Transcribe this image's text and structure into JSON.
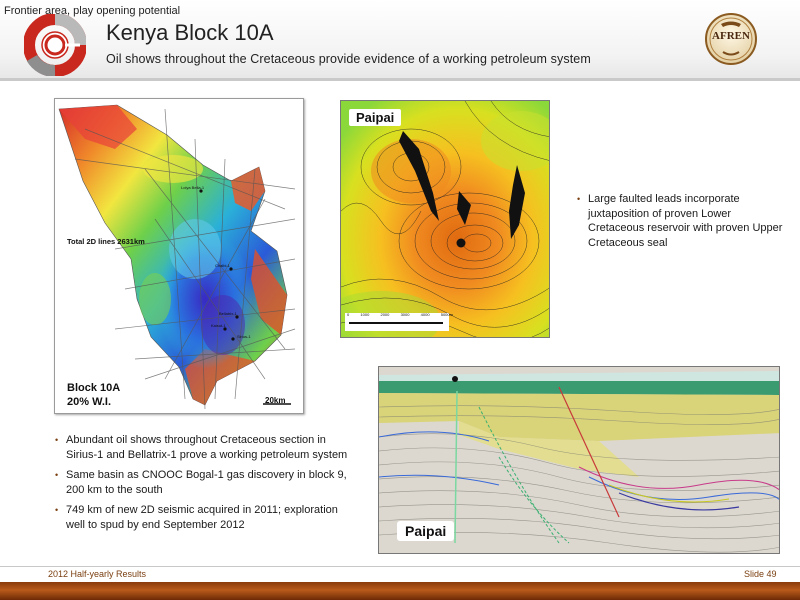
{
  "header": {
    "tagline": "Frontier area, play opening potential",
    "title": "Kenya Block 10A",
    "subtitle": "Oil shows throughout the Cretaceous provide evidence of a working petroleum system",
    "brand": "AFREN"
  },
  "basin_map": {
    "lines_label": "Total 2D lines 2631km",
    "block_label": "Block 10A",
    "interest_label": "20% W.I.",
    "scale_label": "20km",
    "wells": [
      "Loiya Bella-1",
      "Chalbi-1",
      "Bellatrix-1",
      "Kaisut-1",
      "Sirius-1"
    ]
  },
  "contour_map": {
    "label": "Paipai",
    "scale_ticks": [
      "0",
      "1000",
      "2000",
      "3000",
      "4000",
      "5000m"
    ]
  },
  "seismic_section": {
    "label": "Paipai"
  },
  "right_bullets": [
    "Large faulted leads incorporate juxtaposition of proven Lower Cretaceous reservoir with proven Upper Cretaceous seal"
  ],
  "left_bullets": [
    "Abundant oil shows throughout Cretaceous section in Sirius-1 and Bellatrix-1 prove a working petroleum system",
    "Same basin as CNOOC Bogal-1 gas discovery in block 9, 200 km to the south",
    "749 km of new 2D seismic acquired in 2011; exploration well to spud by end September 2012"
  ],
  "footer": {
    "left": "2012 Half-yearly Results",
    "right": "Slide 49"
  },
  "colors": {
    "accent": "#7a3f10",
    "logo_red": "#c8281e",
    "footer_bar": "#9a4612"
  },
  "icons": {
    "left_logo": "ring-logo-icon",
    "brand_badge": "afren-badge-icon"
  }
}
